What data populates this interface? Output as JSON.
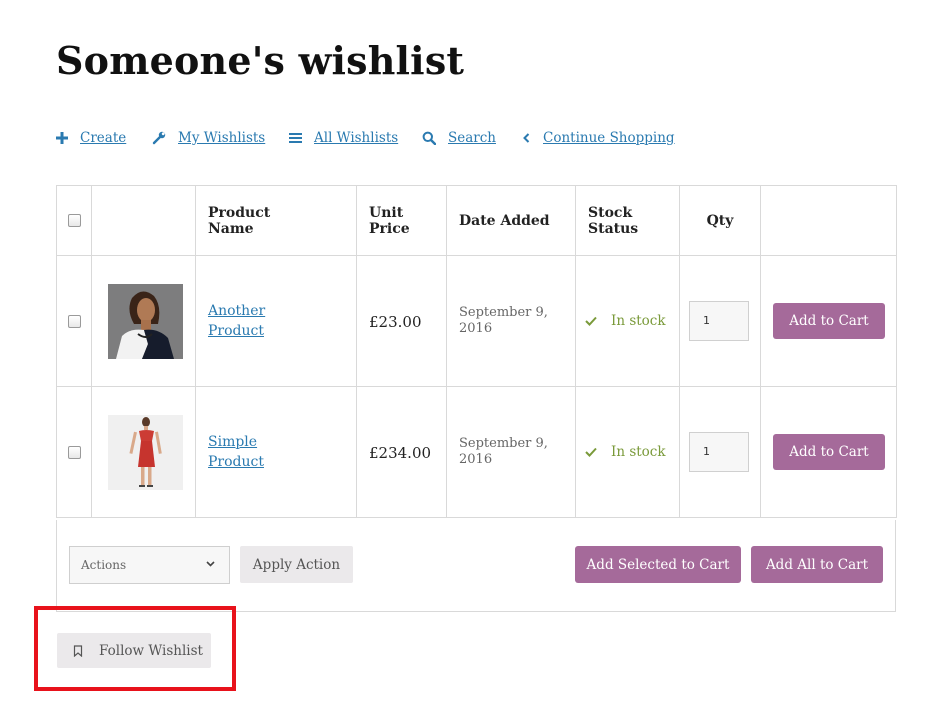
{
  "page": {
    "title": "Someone's wishlist"
  },
  "nav": [
    {
      "label": "Create",
      "icon": "plus-icon"
    },
    {
      "label": "My Wishlists",
      "icon": "wrench-icon"
    },
    {
      "label": "All Wishlists",
      "icon": "list-icon"
    },
    {
      "label": "Search",
      "icon": "search-icon"
    },
    {
      "label": "Continue Shopping",
      "icon": "chevron-left-icon"
    }
  ],
  "table": {
    "headers": {
      "product_name": "Product Name",
      "unit_price": "Unit Price",
      "date_added": "Date Added",
      "stock_status": "Stock Status",
      "qty": "Qty"
    },
    "rows": [
      {
        "name": "Another Product",
        "price": "£23.00",
        "date": "September 9, 2016",
        "stock": "In stock",
        "qty": "1",
        "button": "Add to Cart",
        "thumb": "woman-white-black-dress-photo"
      },
      {
        "name": "Simple Product",
        "price": "£234.00",
        "date": "September 9, 2016",
        "stock": "In stock",
        "qty": "1",
        "button": "Add to Cart",
        "thumb": "woman-red-dress-photo"
      }
    ]
  },
  "footer": {
    "actions_select": "Actions",
    "apply_button": "Apply Action",
    "add_selected_button": "Add Selected to Cart",
    "add_all_button": "Add All to Cart"
  },
  "follow": {
    "label": "Follow Wishlist",
    "icon": "bookmark-icon"
  },
  "colors": {
    "link": "#2a7ab0",
    "accent_purple": "#a56a9a",
    "stock_green": "#7a9a3a",
    "highlight_red": "#e8121b",
    "grey_button": "#ebe9eb"
  }
}
